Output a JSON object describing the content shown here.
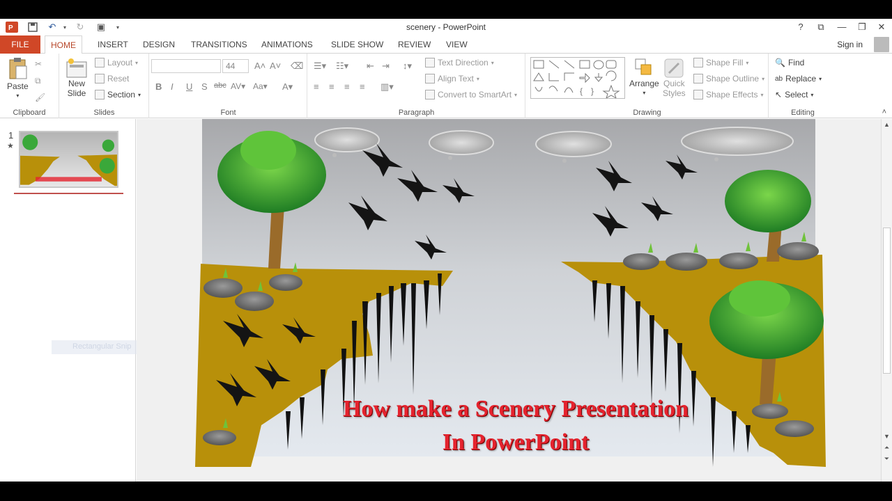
{
  "window": {
    "title": "scenery - PowerPoint"
  },
  "tabs": [
    {
      "label": "FILE"
    },
    {
      "label": "HOME"
    },
    {
      "label": "INSERT"
    },
    {
      "label": "DESIGN"
    },
    {
      "label": "TRANSITIONS"
    },
    {
      "label": "ANIMATIONS"
    },
    {
      "label": "SLIDE SHOW"
    },
    {
      "label": "REVIEW"
    },
    {
      "label": "VIEW"
    }
  ],
  "signin": "Sign in",
  "ribbon": {
    "clipboard": {
      "label": "Clipboard",
      "paste": "Paste"
    },
    "slides": {
      "label": "Slides",
      "new_slide_1": "New",
      "new_slide_2": "Slide",
      "layout": "Layout",
      "reset": "Reset",
      "section": "Section"
    },
    "font": {
      "label": "Font",
      "font_name": "",
      "font_size": "44"
    },
    "paragraph": {
      "label": "Paragraph",
      "text_direction": "Text Direction",
      "align_text": "Align Text",
      "convert_smartart": "Convert to SmartArt"
    },
    "drawing": {
      "label": "Drawing",
      "arrange": "Arrange",
      "quick_1": "Quick",
      "quick_2": "Styles",
      "shape_fill": "Shape Fill",
      "shape_outline": "Shape Outline",
      "shape_effects": "Shape Effects"
    },
    "editing": {
      "label": "Editing",
      "find": "Find",
      "replace": "Replace",
      "select": "Select"
    }
  },
  "slides_pane": {
    "slide_number": "1",
    "ghost_label": "Rectangular Snip"
  },
  "slide": {
    "title_line1": "How make a Scenery Presentation",
    "title_line2": "In PowerPoint"
  },
  "colors": {
    "file_tab": "#d04727",
    "accent": "#b7472a",
    "title_red": "#e5232e",
    "cliff": "#b8900a",
    "leaf": "#3aa83a"
  }
}
